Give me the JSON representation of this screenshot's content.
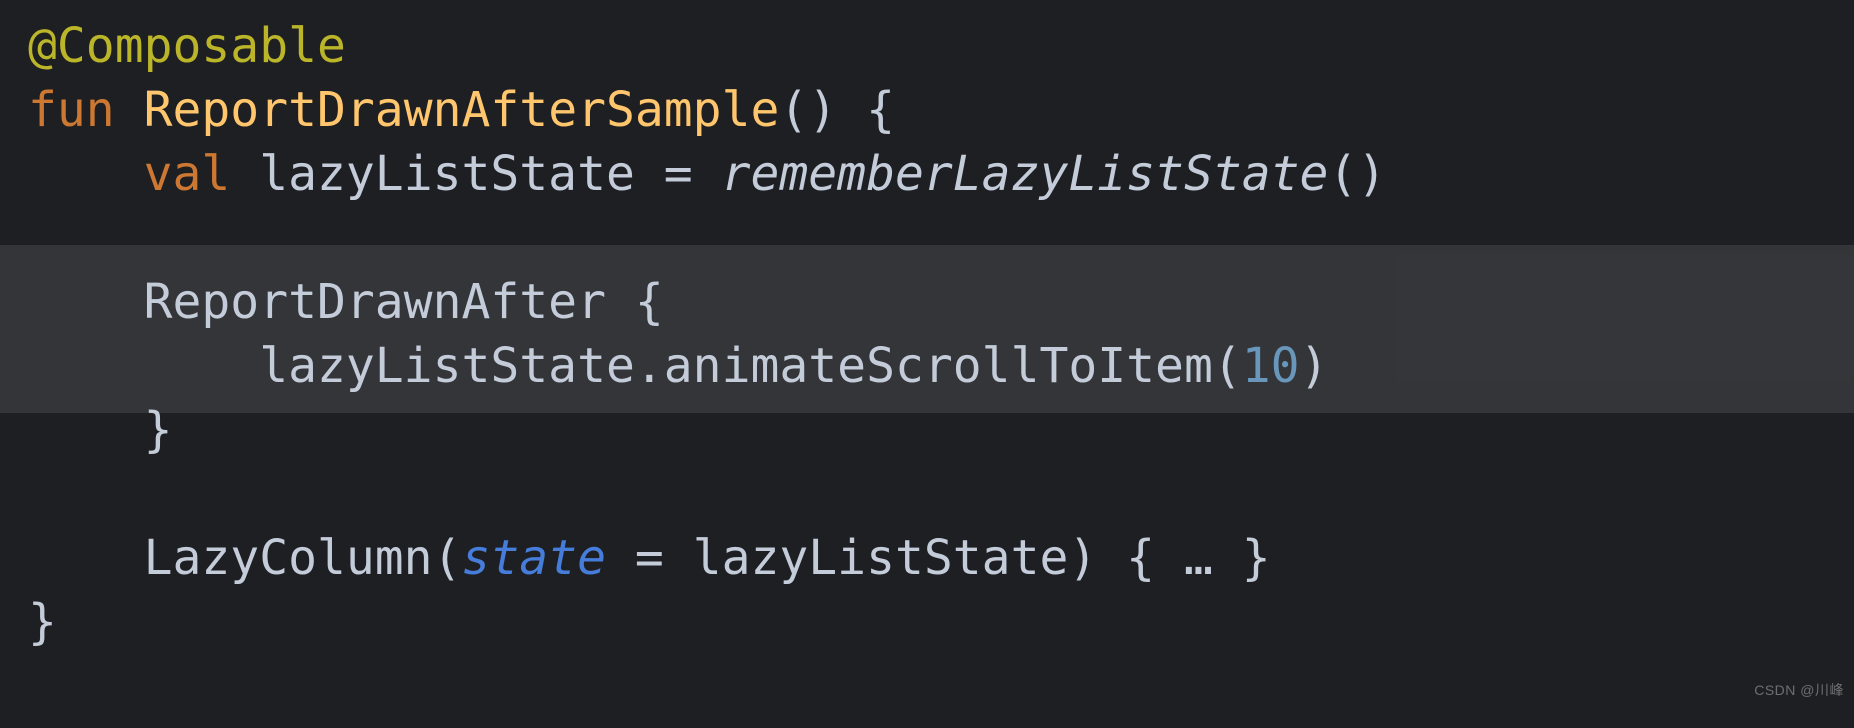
{
  "code": {
    "annotation": "@Composable",
    "fun_keyword": "fun",
    "func_name": "ReportDrawnAfterSample",
    "func_parens_open": "()",
    "brace_open": " {",
    "val_keyword": "val",
    "var_name": " lazyListState ",
    "equals": "= ",
    "remember_call": "rememberLazyListState",
    "remember_parens": "()",
    "report_call": "ReportDrawnAfter ",
    "report_brace_open": "{",
    "inner_obj": "lazyListState",
    "inner_dot": ".",
    "inner_method": "animateScrollToItem",
    "inner_open": "(",
    "inner_arg": "10",
    "inner_close": ")",
    "report_brace_close": "}",
    "lazy_call": "LazyColumn",
    "lazy_open": "(",
    "state_param": "state",
    "state_eq": " = ",
    "state_val": "lazyListState",
    "lazy_close": ")",
    "lazy_body": " { … }",
    "func_brace_close": "}"
  },
  "watermark": "CSDN @川峰"
}
